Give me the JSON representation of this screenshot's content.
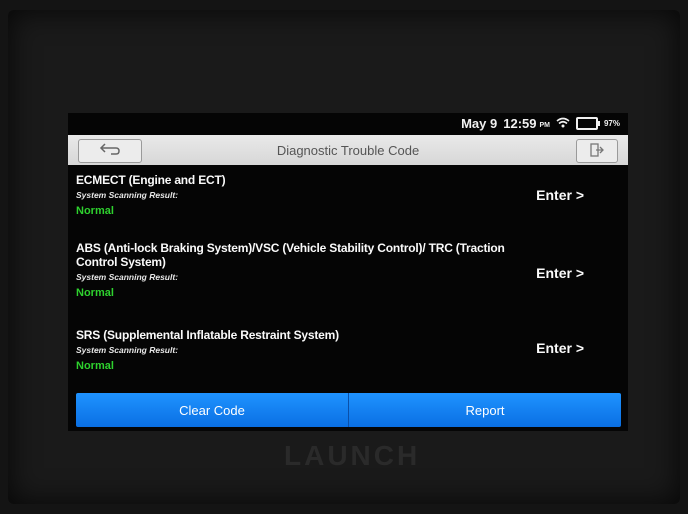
{
  "status": {
    "date": "May 9",
    "time": "12:59",
    "ampm": "PM",
    "battery": "97%",
    "wifi_icon": "wifi-icon",
    "battery_icon": "battery-icon"
  },
  "titlebar": {
    "title": "Diagnostic Trouble Code",
    "back_icon": "back-arrow-icon",
    "exit_icon": "exit-icon"
  },
  "systems": [
    {
      "name": "ECMECT (Engine and ECT)",
      "subtitle": "System Scanning Result:",
      "status": "Normal",
      "action": "Enter >"
    },
    {
      "name": "ABS (Anti-lock Braking System)/VSC (Vehicle Stability Control)/ TRC (Traction Control System)",
      "subtitle": "System Scanning Result:",
      "status": "Normal",
      "action": "Enter >"
    },
    {
      "name": "SRS (Supplemental Inflatable Restraint System)",
      "subtitle": "System Scanning Result:",
      "status": "Normal",
      "action": "Enter >"
    }
  ],
  "footer": {
    "clear_label": "Clear Code",
    "report_label": "Report"
  },
  "device": {
    "brand": "LAUNCH"
  },
  "colors": {
    "accent": "#1a86f5",
    "status_ok": "#2ed12e",
    "background": "#050505"
  }
}
